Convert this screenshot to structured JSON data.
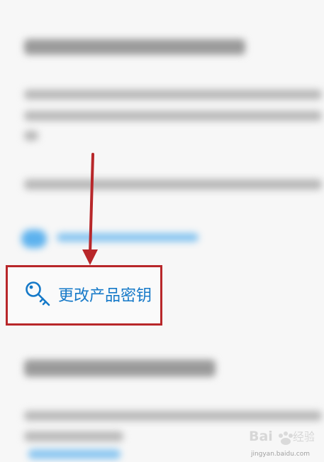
{
  "link": {
    "label": "更改产品密钥",
    "icon": "key-icon",
    "color": "#1579c8"
  },
  "annotation": {
    "arrow_color": "#b8272a",
    "box_color": "#b8272a"
  },
  "watermark": {
    "brand": "Baidu经验",
    "url": "jingyan.baidu.com"
  }
}
